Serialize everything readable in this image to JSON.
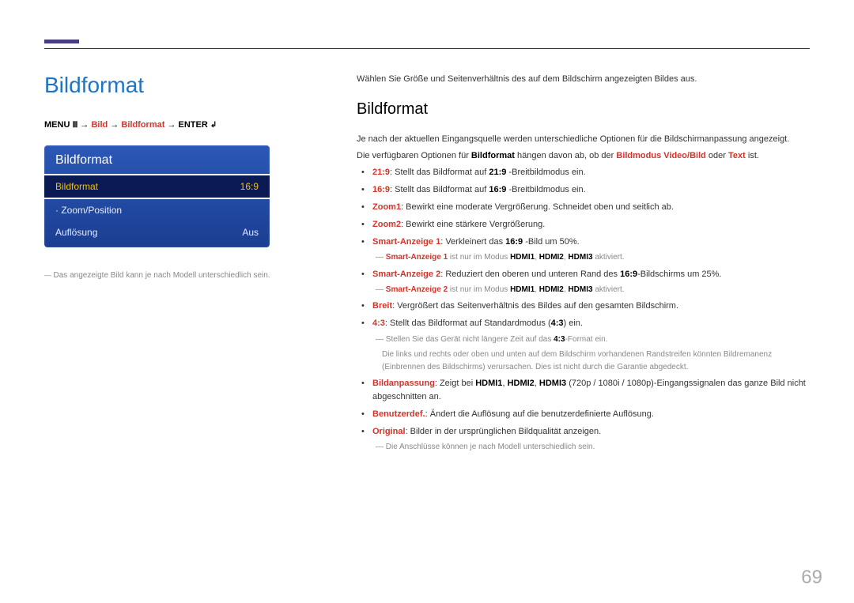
{
  "header": {
    "title": "Bildformat"
  },
  "breadcrumb": {
    "menu": "MENU",
    "arrow": "→",
    "p1": "Bild",
    "p2": "Bildformat",
    "enter": "ENTER"
  },
  "osd": {
    "title": "Bildformat",
    "rows": [
      {
        "label": "Bildformat",
        "value": "16:9",
        "selected": true
      },
      {
        "label": "Zoom/Position",
        "value": "",
        "dot": true
      },
      {
        "label": "Auflösung",
        "value": "Aus"
      }
    ]
  },
  "left_note": "Das angezeigte Bild kann je nach Modell unterschiedlich sein.",
  "right": {
    "intro": "Wählen Sie Größe und Seitenverhältnis des auf dem Bildschirm angezeigten Bildes aus.",
    "h2": "Bildformat",
    "p1": "Je nach der aktuellen Eingangsquelle werden unterschiedliche Optionen für die Bildschirmanpassung angezeigt.",
    "p2_pre": "Die verfügbaren Optionen für ",
    "p2_kw1": "Bildformat",
    "p2_mid": " hängen davon ab, ob der ",
    "p2_kw2": "Bildmodus Video/Bild",
    "p2_or": " oder ",
    "p2_kw3": "Text",
    "p2_post": " ist.",
    "items": {
      "i1_k": "21:9",
      "i1_t": ": Stellt das Bildformat auf ",
      "i1_b": "21:9",
      "i1_t2": " -Breitbildmodus ein.",
      "i2_k": "16:9",
      "i2_t": ": Stellt das Bildformat auf ",
      "i2_b": "16:9",
      "i2_t2": " -Breitbildmodus ein.",
      "i3_k": "Zoom1",
      "i3_t": ": Bewirkt eine moderate Vergrößerung. Schneidet oben und seitlich ab.",
      "i4_k": "Zoom2",
      "i4_t": ": Bewirkt eine stärkere Vergrößerung.",
      "i5_k": "Smart-Anzeige 1",
      "i5_t": ": Verkleinert das ",
      "i5_b": "16:9",
      "i5_t2": " -Bild um 50%.",
      "i5_sub_k": "Smart-Anzeige 1",
      "i5_sub_t": " ist nur im Modus ",
      "i5_sub_h1": "HDMI1",
      "i5_sub_c": ", ",
      "i5_sub_h2": "HDMI2",
      "i5_sub_h3": "HDMI3",
      "i5_sub_end": " aktiviert.",
      "i6_k": "Smart-Anzeige 2",
      "i6_t": ": Reduziert den oberen und unteren Rand des ",
      "i6_b": "16:9",
      "i6_t2": "-Bildschirms um 25%.",
      "i6_sub_k": "Smart-Anzeige 2",
      "i6_sub_t": " ist nur im Modus ",
      "i6_sub_h1": "HDMI1",
      "i6_sub_h2": "HDMI2",
      "i6_sub_h3": "HDMI3",
      "i6_sub_end": " aktiviert.",
      "i7_k": "Breit",
      "i7_t": ": Vergrößert das Seitenverhältnis des Bildes auf den gesamten Bildschirm.",
      "i8_k": "4:3",
      "i8_t": ": Stellt das Bildformat auf Standardmodus (",
      "i8_b": "4:3",
      "i8_t2": ") ein.",
      "i8_sub1": "Stellen Sie das Gerät nicht längere Zeit auf das ",
      "i8_sub1_b": "4:3",
      "i8_sub1_t2": "-Format ein.",
      "i8_sub2": "Die links und rechts oder oben und unten auf dem Bildschirm vorhandenen Randstreifen könnten Bildremanenz (Einbrennen des Bildschirms) verursachen. Dies ist nicht durch die Garantie abgedeckt.",
      "i9_k": "Bildanpassung",
      "i9_t": ": Zeigt bei ",
      "i9_h1": "HDMI1",
      "i9_h2": "HDMI2",
      "i9_h3": "HDMI3",
      "i9_t2": " (720p / 1080i / 1080p)-Eingangssignalen das ganze Bild nicht abgeschnitten an.",
      "i10_k": "Benutzerdef.",
      "i10_t": ": Ändert die Auflösung auf die benutzerdefinierte Auflösung.",
      "i11_k": "Original",
      "i11_t": ": Bilder in der ursprünglichen Bildqualität anzeigen.",
      "i11_sub": "Die Anschlüsse können je nach Modell unterschiedlich sein."
    }
  },
  "page_number": "69"
}
